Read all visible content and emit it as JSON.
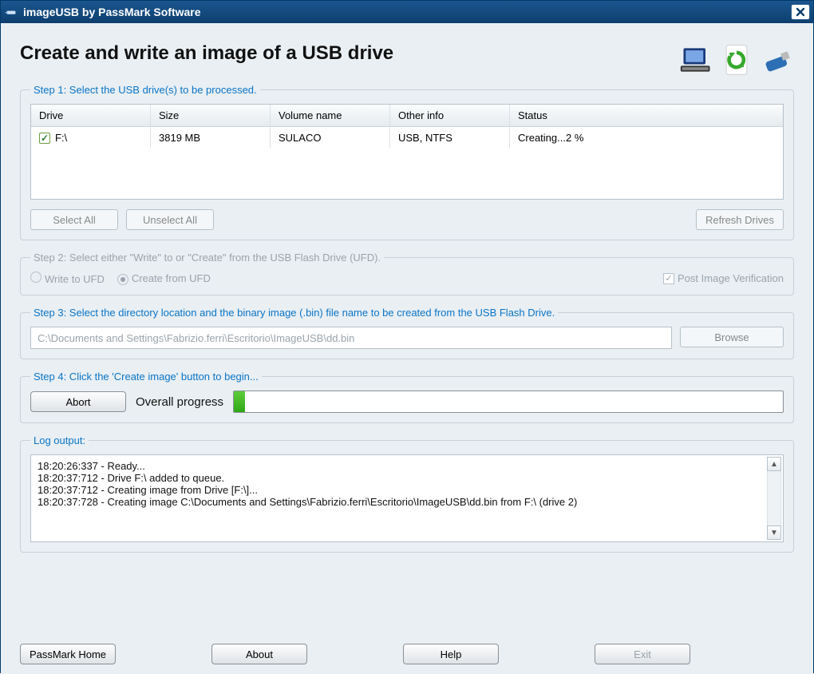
{
  "window": {
    "title": "imageUSB by PassMark Software"
  },
  "headline": "Create and write an image of a USB drive",
  "step1": {
    "legend": "Step 1: Select the USB drive(s) to be processed.",
    "columns": {
      "drive": "Drive",
      "size": "Size",
      "volume": "Volume name",
      "other": "Other info",
      "status": "Status"
    },
    "rows": [
      {
        "checked": true,
        "drive": "F:\\",
        "size": "3819 MB",
        "volume": "SULACO",
        "other": "USB, NTFS",
        "status": "Creating...2 %"
      }
    ],
    "buttons": {
      "select_all": "Select All",
      "unselect_all": "Unselect All",
      "refresh": "Refresh Drives"
    }
  },
  "step2": {
    "legend": "Step 2: Select either \"Write\" to or \"Create\" from the USB Flash Drive (UFD).",
    "write_label": "Write to UFD",
    "create_label": "Create from UFD",
    "selected": "create",
    "post_verify_label": "Post Image Verification",
    "post_verify_checked": true
  },
  "step3": {
    "legend": "Step 3: Select the directory location and the binary image (.bin) file name to be created from the USB Flash Drive.",
    "path": "C:\\Documents and Settings\\Fabrizio.ferri\\Escritorio\\ImageUSB\\dd.bin",
    "browse": "Browse"
  },
  "step4": {
    "legend": "Step 4: Click the 'Create image' button to begin...",
    "abort": "Abort",
    "progress_label": "Overall progress",
    "progress_percent": 2
  },
  "log": {
    "legend": "Log output:",
    "lines": [
      "18:20:26:337 - Ready...",
      "18:20:37:712 - Drive F:\\ added to queue.",
      "18:20:37:712 - Creating image from Drive [F:\\]...",
      "18:20:37:728 - Creating image C:\\Documents and Settings\\Fabrizio.ferri\\Escritorio\\ImageUSB\\dd.bin from F:\\ (drive 2)"
    ]
  },
  "footer": {
    "home": "PassMark Home",
    "about": "About",
    "help": "Help",
    "exit": "Exit"
  }
}
